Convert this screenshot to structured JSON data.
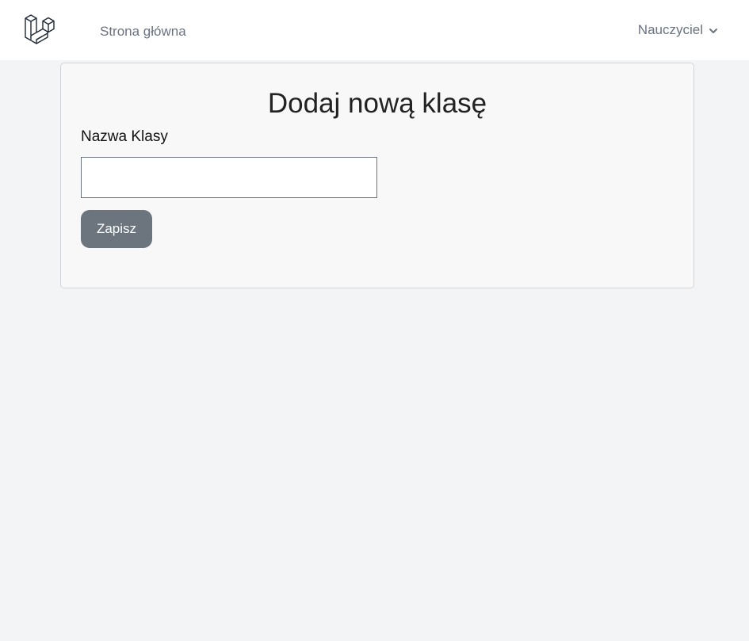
{
  "navbar": {
    "logo_icon": "laravel-logo-icon",
    "home_link": "Strona główna",
    "user_menu": {
      "label": "Nauczyciel",
      "icon": "chevron-down-icon"
    }
  },
  "form": {
    "title": "Dodaj nową klasę",
    "class_name_label": "Nazwa Klasy",
    "class_name_value": "",
    "save_label": "Zapisz"
  },
  "colors": {
    "page_bg": "#f3f4f6",
    "card_bg": "#f8f8f8",
    "button_bg": "#6c757d",
    "nav_text": "#6b7280"
  }
}
